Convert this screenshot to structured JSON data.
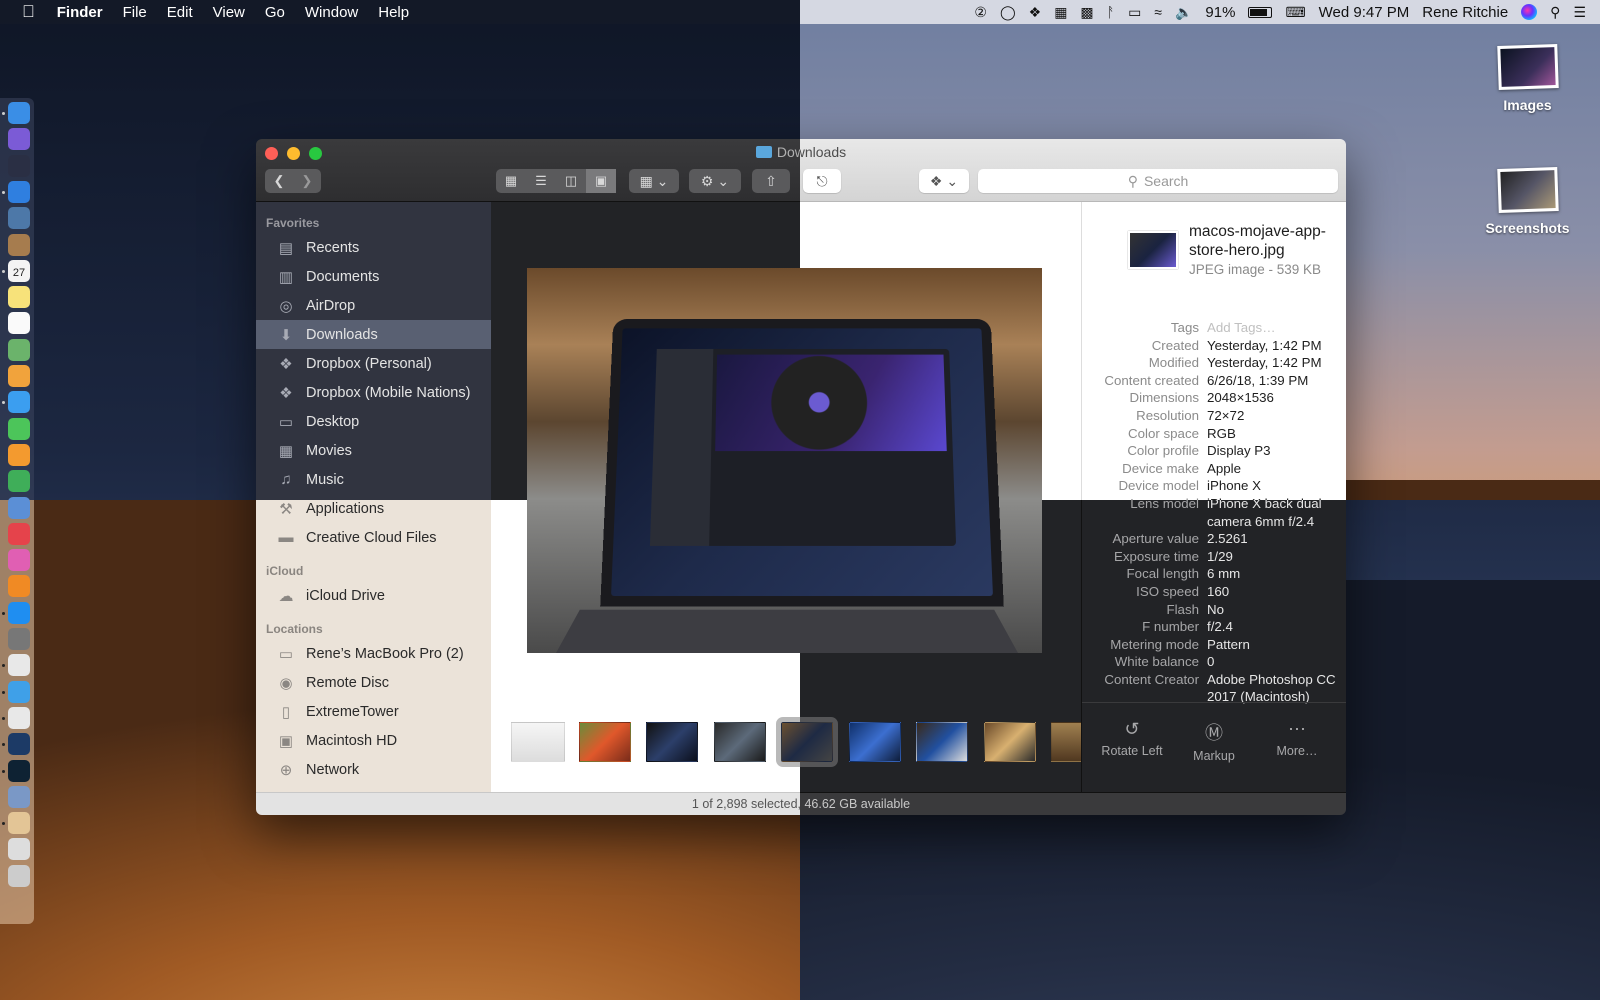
{
  "menubar": {
    "apple": "",
    "app_name": "Finder",
    "menus": [
      "File",
      "Edit",
      "View",
      "Go",
      "Window",
      "Help"
    ],
    "status": {
      "battery_percent": "91%",
      "clock": "Wed 9:47 PM",
      "user": "Rene Ritchie"
    },
    "status_icons": [
      "1password-icon",
      "creative-cloud-icon",
      "dropbox-icon",
      "bartender-icon",
      "gear-menu-icon",
      "bluetooth-icon",
      "airplay-icon",
      "wifi-icon",
      "volume-icon",
      "battery-icon",
      "keyboard-viewer-icon",
      "siri-icon",
      "spotlight-icon",
      "notification-center-icon"
    ]
  },
  "desktop": {
    "items": [
      {
        "label": "Images"
      },
      {
        "label": "Screenshots"
      }
    ]
  },
  "dock": {
    "apps": [
      "Finder",
      "Siri",
      "Launchpad",
      "Safari",
      "Preview",
      "Contacts",
      "Calendar",
      "Notes",
      "Reminders",
      "Maps",
      "Photos",
      "Messages",
      "FaceTime",
      "Pages",
      "Numbers",
      "Keynote",
      "News",
      "iTunes",
      "Books",
      "App Store",
      "System Preferences",
      "Slack",
      "Tweetbot",
      "Chrome",
      "QuickTime Player",
      "Photoshop",
      "Image Capture",
      "Mail",
      "Downloads Stack",
      "Trash"
    ],
    "calendar_day": "27"
  },
  "window": {
    "title": "Downloads",
    "toolbar": {
      "search_placeholder": "Search"
    },
    "sidebar": {
      "sections": [
        {
          "header": "Favorites",
          "items": [
            {
              "label": "Recents",
              "icon": "recents-icon",
              "selected": false
            },
            {
              "label": "Documents",
              "icon": "documents-icon",
              "selected": false
            },
            {
              "label": "AirDrop",
              "icon": "airdrop-icon",
              "selected": false
            },
            {
              "label": "Downloads",
              "icon": "downloads-icon",
              "selected": true
            },
            {
              "label": "Dropbox (Personal)",
              "icon": "dropbox-icon",
              "selected": false
            },
            {
              "label": "Dropbox (Mobile Nations)",
              "icon": "dropbox-icon",
              "selected": false
            },
            {
              "label": "Desktop",
              "icon": "desktop-icon",
              "selected": false
            },
            {
              "label": "Movies",
              "icon": "movies-icon",
              "selected": false
            },
            {
              "label": "Music",
              "icon": "music-icon",
              "selected": false
            },
            {
              "label": "Applications",
              "icon": "applications-icon",
              "selected": false
            },
            {
              "label": "Creative Cloud Files",
              "icon": "folder-icon",
              "selected": false
            }
          ]
        },
        {
          "header": "iCloud",
          "items": [
            {
              "label": "iCloud Drive",
              "icon": "icloud-icon",
              "selected": false
            }
          ]
        },
        {
          "header": "Locations",
          "items": [
            {
              "label": "Rene’s MacBook Pro (2)",
              "icon": "laptop-icon",
              "selected": false
            },
            {
              "label": "Remote Disc",
              "icon": "disc-icon",
              "selected": false
            },
            {
              "label": "ExtremeTower",
              "icon": "airport-icon",
              "selected": false
            },
            {
              "label": "Macintosh HD",
              "icon": "hard-drive-icon",
              "selected": false
            },
            {
              "label": "Network",
              "icon": "network-icon",
              "selected": false
            }
          ]
        }
      ]
    },
    "inspector": {
      "file_name": "macos-mojave-app-store-hero.jpg",
      "file_kind": "JPEG image - 539 KB",
      "metadata": [
        {
          "key": "Tags",
          "value": "Add Tags…",
          "placeholder": true
        },
        {
          "key": "Created",
          "value": "Yesterday, 1:42 PM"
        },
        {
          "key": "Modified",
          "value": "Yesterday, 1:42 PM"
        },
        {
          "key": "Content created",
          "value": "6/26/18, 1:39 PM"
        },
        {
          "key": "Dimensions",
          "value": "2048×1536"
        },
        {
          "key": "Resolution",
          "value": "72×72"
        },
        {
          "key": "Color space",
          "value": "RGB"
        },
        {
          "key": "Color profile",
          "value": "Display P3"
        },
        {
          "key": "Device make",
          "value": "Apple"
        },
        {
          "key": "Device model",
          "value": "iPhone X"
        },
        {
          "key": "Lens model",
          "value": "iPhone X back dual camera 6mm f/2.4"
        },
        {
          "key": "Aperture value",
          "value": "2.5261"
        },
        {
          "key": "Exposure time",
          "value": "1/29"
        },
        {
          "key": "Focal length",
          "value": "6 mm"
        },
        {
          "key": "ISO speed",
          "value": "160"
        },
        {
          "key": "Flash",
          "value": "No"
        },
        {
          "key": "F number",
          "value": "f/2.4"
        },
        {
          "key": "Metering mode",
          "value": "Pattern"
        },
        {
          "key": "White balance",
          "value": "0"
        },
        {
          "key": "Content Creator",
          "value": "Adobe Photoshop CC 2017 (Macintosh)"
        }
      ],
      "actions": [
        {
          "label": "Rotate Left",
          "icon": "rotate-left-icon"
        },
        {
          "label": "Markup",
          "icon": "markup-icon"
        },
        {
          "label": "More…",
          "icon": "more-icon"
        }
      ]
    },
    "gallery": {
      "selected_index": 4,
      "thumbnail_count": 9
    },
    "status_bar": "1 of 2,898 selected, 46.62 GB available"
  },
  "colors": {
    "traffic_red": "#fe5f57",
    "traffic_yellow": "#febc2e",
    "traffic_green": "#28c840",
    "folder_blue": "#5aa7dd"
  }
}
